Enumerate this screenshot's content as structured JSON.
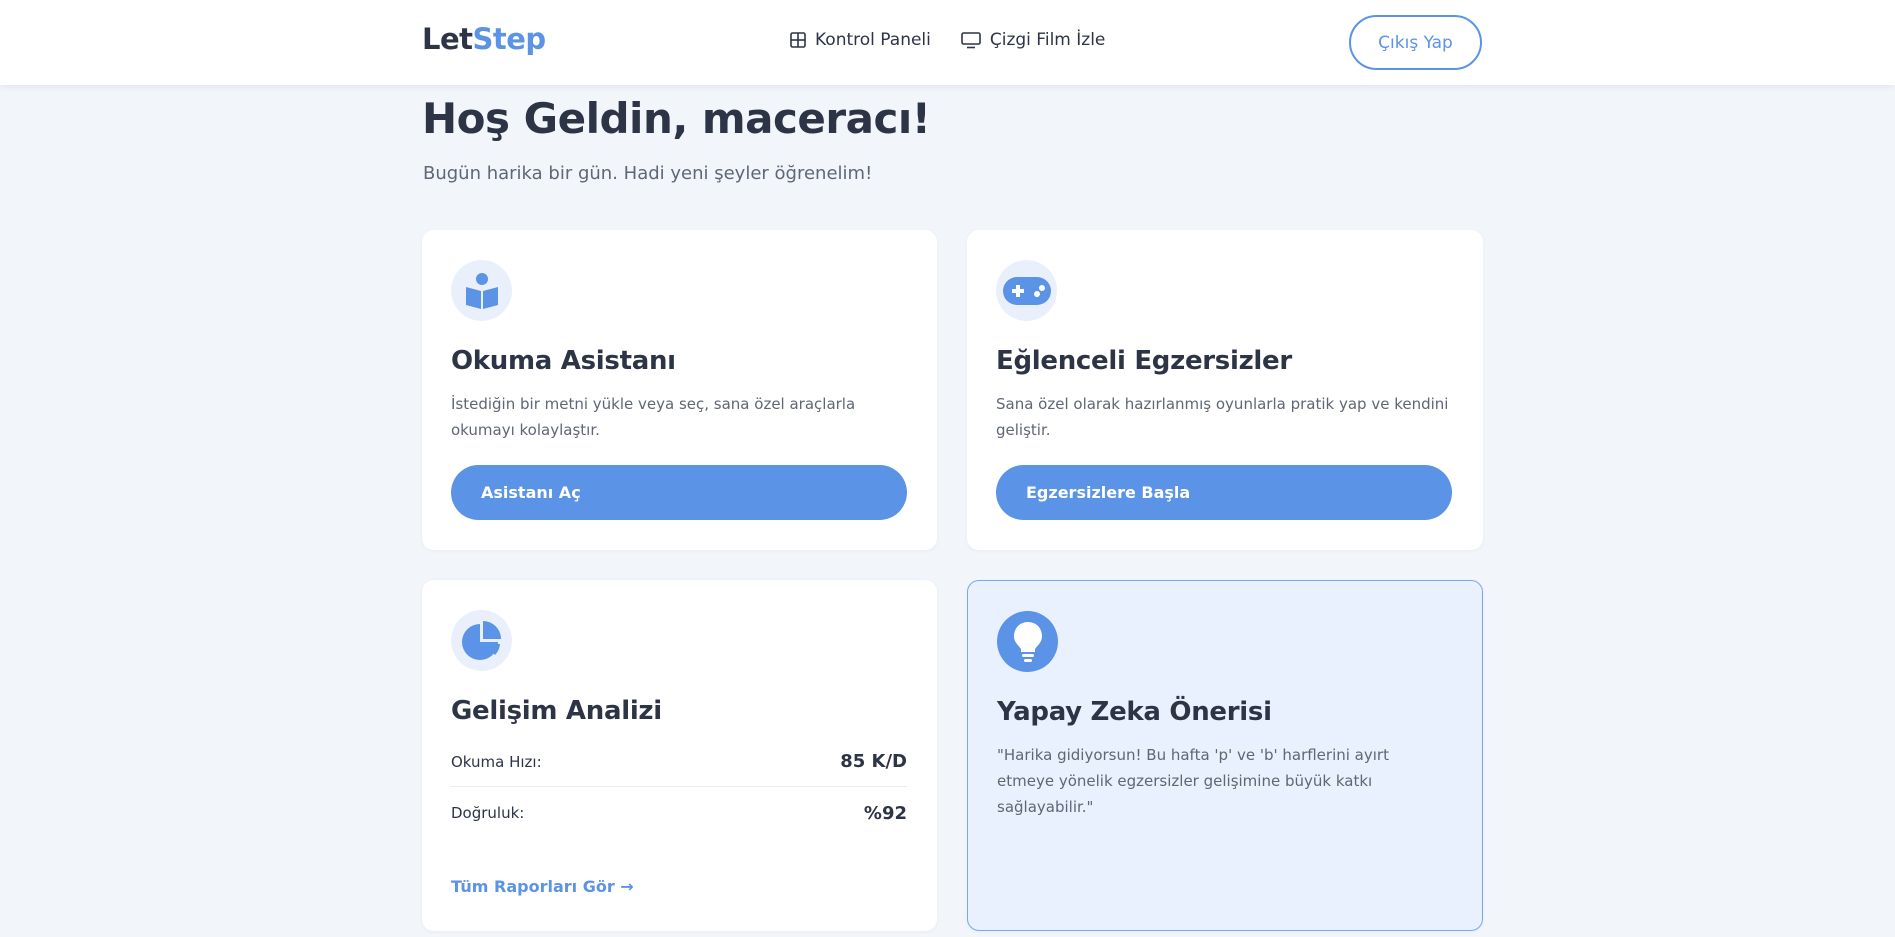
{
  "header": {
    "logo_part1": "Let",
    "logo_part2": "Step",
    "nav": [
      {
        "label": "Kontrol Paneli",
        "icon": "grid-icon"
      },
      {
        "label": "Çizgi Film İzle",
        "icon": "monitor-icon"
      }
    ],
    "logout_label": "Çıkış Yap"
  },
  "welcome": {
    "title": "Hoş Geldin, maceracı!",
    "subtitle": "Bugün harika bir gün. Hadi yeni şeyler öğrenelim!"
  },
  "cards": {
    "reading": {
      "icon": "book-reader-icon",
      "title": "Okuma Asistanı",
      "description": "İstediğin bir metni yükle veya seç, sana özel araçlarla okumayı kolaylaştır.",
      "button": "Asistanı Aç"
    },
    "exercises": {
      "icon": "gamepad-icon",
      "title": "Eğlenceli Egzersizler",
      "description": "Sana özel olarak hazırlanmış oyunlarla pratik yap ve kendini geliştir.",
      "button": "Egzersizlere Başla"
    },
    "analysis": {
      "icon": "pie-chart-icon",
      "title": "Gelişim Analizi",
      "stats": [
        {
          "label": "Okuma Hızı:",
          "value": "85 K/D"
        },
        {
          "label": "Doğruluk:",
          "value": "%92"
        }
      ],
      "link": "Tüm Raporları Gör →"
    },
    "ai": {
      "icon": "lightbulb-icon",
      "title": "Yapay Zeka Önerisi",
      "text": "\"Harika gidiyorsun! Bu hafta 'p' ve 'b' harflerini ayırt etmeye yönelik egzersizler gelişimine büyük katkı sağlayabilir.\""
    }
  },
  "colors": {
    "accent": "#5b93e6",
    "background": "#f2f6fa",
    "text": "#2d3446",
    "muted": "#5f6676",
    "ai_card_bg": "#e9f1fe"
  }
}
